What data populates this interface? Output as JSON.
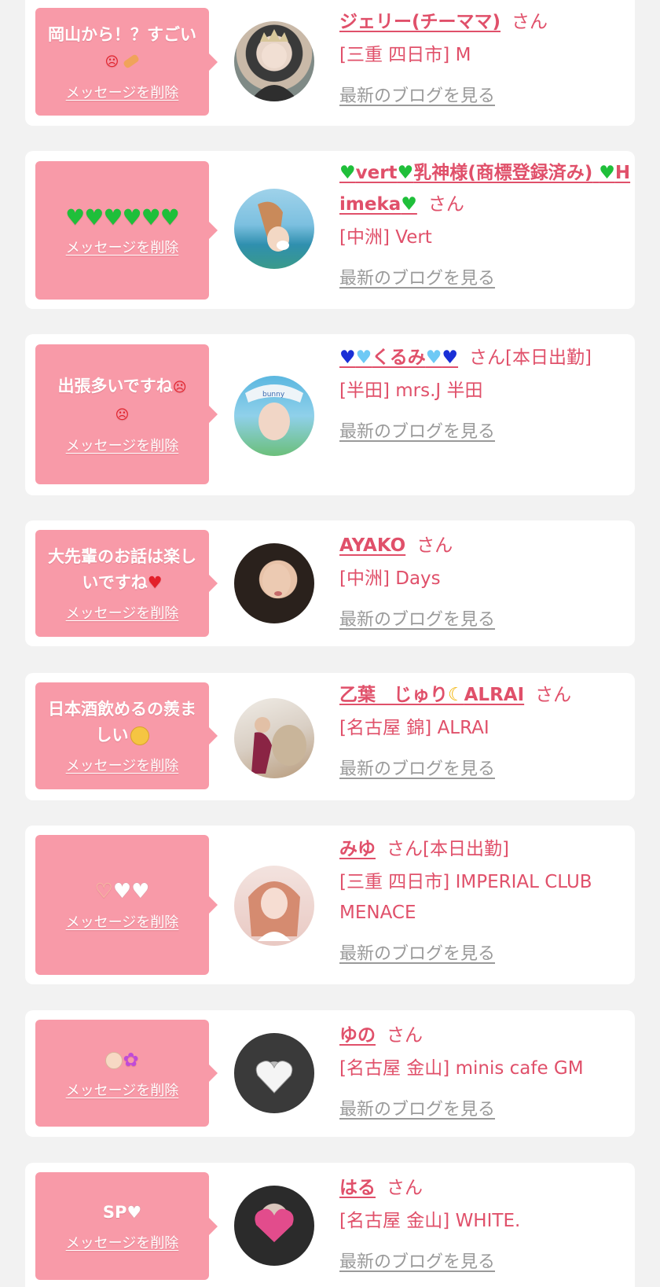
{
  "delete_label": "メッセージを削除",
  "blog_label": "最新のブログを見る",
  "san_suffix": "さん",
  "colors": {
    "bubble": "#f89aa8",
    "name": "#e0506a",
    "link_gray": "#9a9a9a",
    "background": "#f2f2f2"
  },
  "items": [
    {
      "message": "岡山から！？すごい",
      "message_icons": [
        "sad-face-icon",
        "bandage-icon"
      ],
      "name": "ジェリー(チーママ)",
      "suffix": "さん",
      "shop": "[三重 四日市] M"
    },
    {
      "message": "",
      "message_icons": [
        "green-heart-icon",
        "green-heart-icon",
        "green-heart-icon",
        "green-heart-icon",
        "green-heart-icon",
        "green-heart-icon"
      ],
      "name_part1": "vert",
      "name_part2": "乳神様(商標登録済み)",
      "name_part3": "Himeka",
      "suffix": "さん",
      "shop": "[中洲] Vert"
    },
    {
      "message": "出張多いですね",
      "message_icons": [
        "sad-face-icon",
        "sad-face-icon"
      ],
      "name": "くるみ",
      "suffix": "さん[本日出勤]",
      "shop": "[半田] mrs.J 半田"
    },
    {
      "message": "大先輩のお話は楽しいですね",
      "message_icons": [
        "red-heart-icon"
      ],
      "name": "AYAKO",
      "suffix": "さん",
      "shop": "[中洲] Days"
    },
    {
      "message": "日本酒飲めるの羨ましい",
      "message_icons": [
        "pleading-face-icon"
      ],
      "name_part1": "乙葉　じゅり",
      "name_part2": "ALRAI",
      "suffix": "さん",
      "shop": "[名古屋 錦] ALRAI"
    },
    {
      "message": "",
      "message_icons": [
        "heart-hands-icon",
        "white-heart-icon",
        "white-heart-icon"
      ],
      "name": "みゆ",
      "suffix": "さん[本日出勤]",
      "shop": "[三重 四日市] IMPERIAL CLUB MENACE"
    },
    {
      "message": "",
      "message_icons": [
        "baby-face-icon",
        "flower-icon"
      ],
      "name": "ゆの",
      "suffix": "さん",
      "shop": "[名古屋 金山] minis cafe GM"
    },
    {
      "message": "SP",
      "message_icons": [
        "white-heart-icon"
      ],
      "name": "はる",
      "suffix": "さん",
      "shop": "[名古屋 金山] WHITE."
    }
  ]
}
